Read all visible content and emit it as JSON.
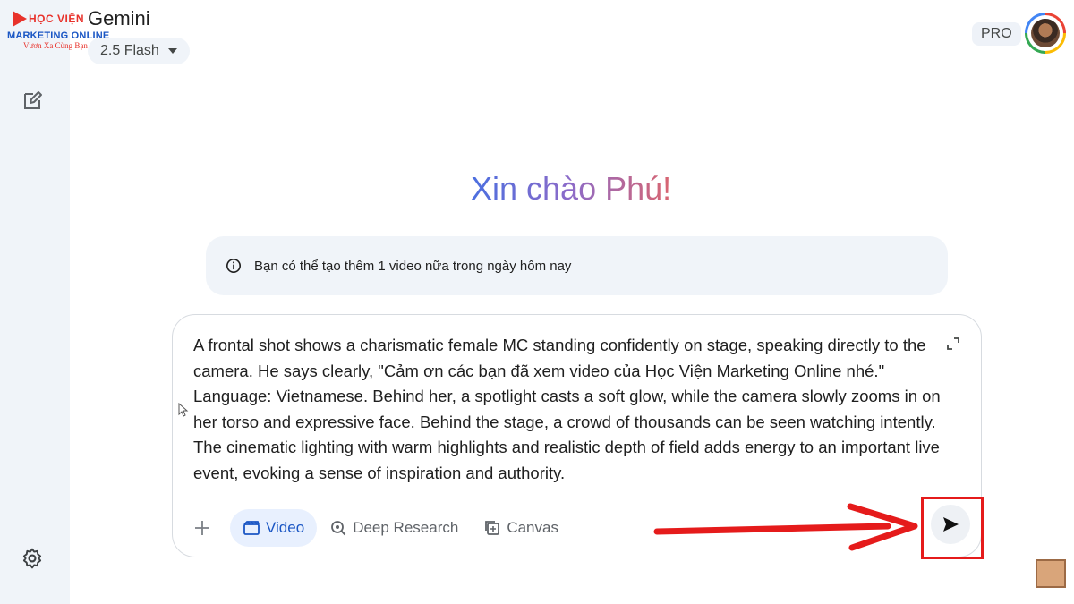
{
  "logo": {
    "line1": "HỌC VIỆN",
    "line2": "MARKETING ONLINE",
    "line3": "Vươn Xa Cùng Bạn"
  },
  "header": {
    "app_title": "Gemini",
    "model": "2.5 Flash",
    "plan_badge": "PRO"
  },
  "sidebar": {
    "icons": [
      "new-chat-icon",
      "settings-icon"
    ]
  },
  "main": {
    "greeting": "Xin chào Phú!",
    "notice": "Bạn có thể tạo thêm 1 video nữa trong ngày hôm nay"
  },
  "composer": {
    "prompt": "A frontal shot shows a charismatic female MC standing confidently on stage, speaking directly to the camera. He says clearly, \"Cảm ơn các bạn đã xem video của Học Viện Marketing Online nhé.\" Language: Vietnamese. Behind her, a spotlight casts a soft glow, while the camera slowly zooms in on her torso and expressive face. Behind the stage, a crowd of thousands can be seen watching intently. The cinematic lighting with warm highlights and realistic depth of field adds energy to an important live event, evoking a sense of inspiration and authority.",
    "tools": {
      "video": "Video",
      "deep_research": "Deep Research",
      "canvas": "Canvas"
    }
  },
  "colors": {
    "accent_blue": "#1a56c4",
    "annotation_red": "#e51b1b",
    "sidebar_bg": "#f0f4f9"
  }
}
